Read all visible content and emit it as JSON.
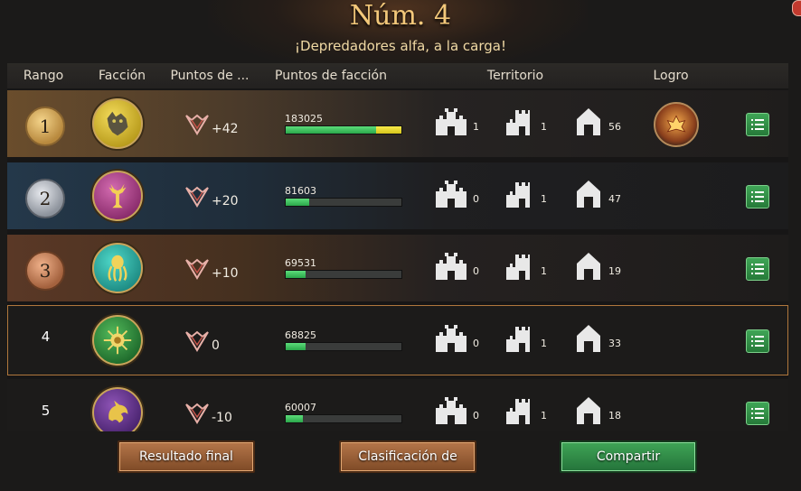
{
  "title": "Núm. 4",
  "subtitle": "¡Depredadores alfa, a la carga!",
  "header": {
    "rank": "Rango",
    "faction": "Facción",
    "points": "Puntos de ...",
    "faction_points": "Puntos de facción",
    "territory": "Territorio",
    "achievement": "Logro"
  },
  "faction_points_max": 183025,
  "rows": [
    {
      "rank": "1",
      "faction_icon": "direwolf-sigil-icon",
      "points": "+42",
      "faction_points": "183025",
      "faction_points_value": 183025,
      "t1": "1",
      "t2": "1",
      "t3": "56",
      "achievement": "flame-crest-icon"
    },
    {
      "rank": "2",
      "faction_icon": "stag-sigil-icon",
      "points": "+20",
      "faction_points": "81603",
      "faction_points_value": 81603,
      "t1": "0",
      "t2": "1",
      "t3": "47",
      "achievement": null
    },
    {
      "rank": "3",
      "faction_icon": "kraken-sigil-icon",
      "points": "+10",
      "faction_points": "69531",
      "faction_points_value": 69531,
      "t1": "0",
      "t2": "1",
      "t3": "19",
      "achievement": null
    },
    {
      "rank": "4",
      "faction_icon": "sun-spear-sigil-icon",
      "points": "0",
      "faction_points": "68825",
      "faction_points_value": 68825,
      "t1": "0",
      "t2": "1",
      "t3": "33",
      "achievement": null
    },
    {
      "rank": "5",
      "faction_icon": "dragon-sigil-icon",
      "points": "-10",
      "faction_points": "60007",
      "faction_points_value": 60007,
      "t1": "0",
      "t2": "1",
      "t3": "18",
      "achievement": null
    }
  ],
  "buttons": {
    "final_result": "Resultado final",
    "ranking": "Clasificación de",
    "share": "Compartir"
  },
  "colors": {
    "title": "#f3c87a",
    "bar_fill": "#3cc061",
    "bar_overflow": "#e8d92a",
    "selected_outline": "#b0773c",
    "detail_button": "#3fa556"
  }
}
